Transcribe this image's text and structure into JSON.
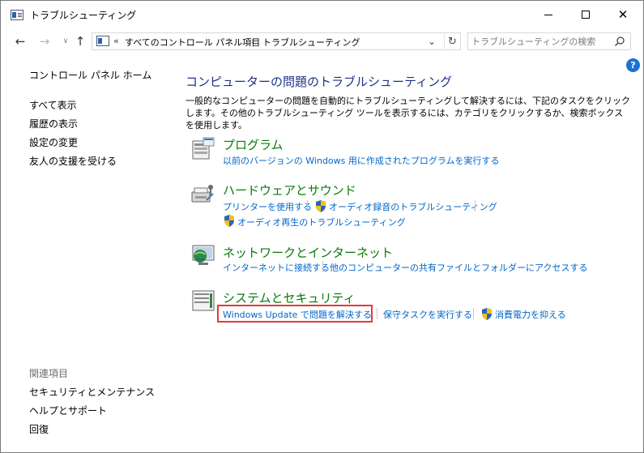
{
  "window": {
    "title": "トラブルシューティング"
  },
  "nav": {
    "chevrons": "«",
    "breadcrumb": [
      "すべてのコントロール パネル項目",
      "トラブルシューティング"
    ],
    "separator": "›",
    "search_placeholder": "トラブルシューティングの検索"
  },
  "sidebar": {
    "home": "コントロール パネル ホーム",
    "items": [
      "すべて表示",
      "履歴の表示",
      "設定の変更",
      "友人の支援を受ける"
    ],
    "related_header": "関連項目",
    "related": [
      "セキュリティとメンテナンス",
      "ヘルプとサポート",
      "回復"
    ]
  },
  "main": {
    "title": "コンピューターの問題のトラブルシューティング",
    "description": "一般的なコンピューターの問題を自動的にトラブルシューティングして解決するには、下記のタスクをクリックします。その他のトラブルシューティング ツールを表示するには、カテゴリをクリックするか、検索ボックスを使用します。",
    "categories": [
      {
        "title": "プログラム",
        "icon": "programs-icon",
        "links": [
          "以前のバージョンの Windows 用に作成されたプログラムを実行する"
        ]
      },
      {
        "title": "ハードウェアとサウンド",
        "icon": "hardware-sound-icon",
        "links": [
          "プリンターを使用する",
          "オーディオ録音のトラブルシューティング",
          "オーディオ再生のトラブルシューティング"
        ]
      },
      {
        "title": "ネットワークとインターネット",
        "icon": "network-icon",
        "links": [
          "インターネットに接続する",
          "他のコンピューターの共有ファイルとフォルダーにアクセスする"
        ]
      },
      {
        "title": "システムとセキュリティ",
        "icon": "system-security-icon",
        "links": [
          "Windows Update で問題を解決する",
          "保守タスクを実行する",
          "消費電力を抑える"
        ]
      }
    ]
  },
  "colors": {
    "category_title": "#0a7a0a",
    "link": "#0066cc",
    "heading": "#1e3287",
    "highlight": "#e23a3a"
  }
}
